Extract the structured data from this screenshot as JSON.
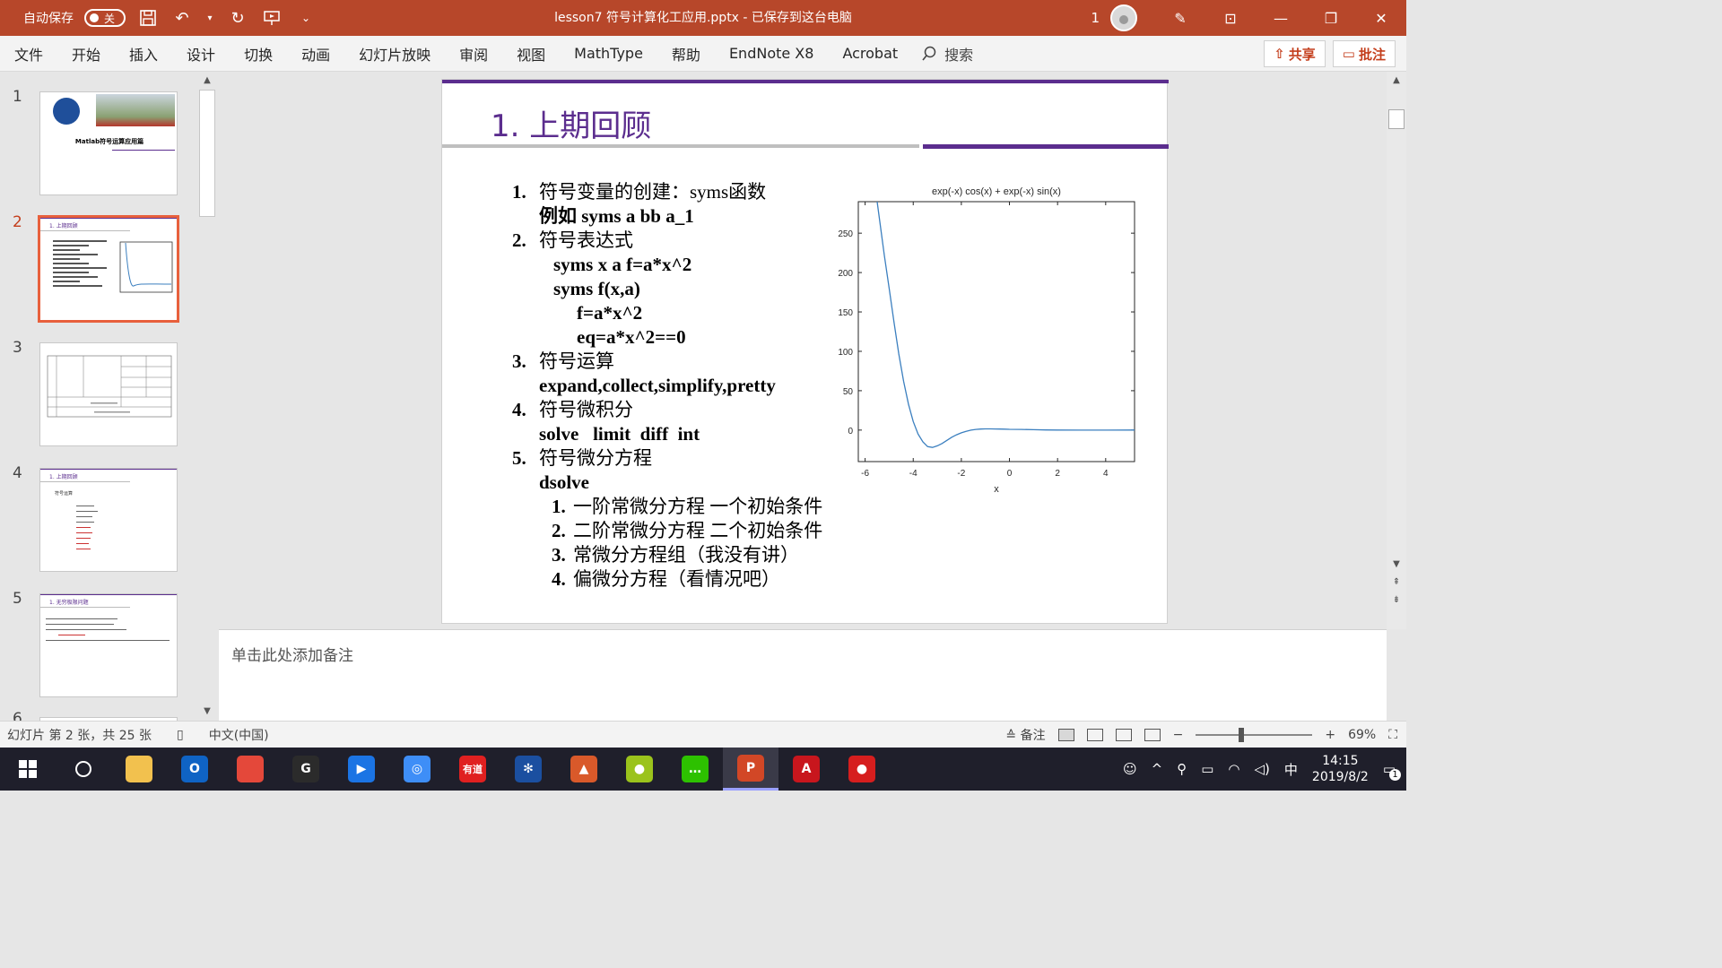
{
  "titlebar": {
    "autosave_label": "自动保存",
    "autosave_state": "关",
    "document_title": "lesson7 符号计算化工应用.pptx - 已保存到这台电脑",
    "account_number": "1",
    "accent_color": "#b7472a"
  },
  "ribbon": {
    "tabs": [
      "文件",
      "开始",
      "插入",
      "设计",
      "切换",
      "动画",
      "幻灯片放映",
      "审阅",
      "视图",
      "MathType",
      "帮助",
      "EndNote X8",
      "Acrobat"
    ],
    "search_label": "搜索",
    "share_label": "共享",
    "comment_label": "批注"
  },
  "thumbnails": {
    "numbers": [
      "1",
      "2",
      "3",
      "4",
      "5",
      "6"
    ],
    "selected": "2",
    "thumb1_title": "Matlab符号运算应用篇",
    "thumb2_title": "1. 上期回顾",
    "thumb4_title": "1. 上期回顾",
    "thumb4_sub": "符号运算",
    "thumb5_title": "1. 无穷极限问题"
  },
  "slide": {
    "title": "1. 上期回顾",
    "accent_color": "#5b2d8e",
    "lines": [
      {
        "num": "1.",
        "text": "符号变量的创建：syms函数"
      },
      {
        "num": "",
        "text": "例如 syms a bb a_1"
      },
      {
        "num": "2.",
        "text": "符号表达式"
      },
      {
        "num": "",
        "text": "syms x a   f=a*x^2"
      },
      {
        "num": "",
        "text": "syms f(x,a)"
      },
      {
        "num": "",
        "text": "f=a*x^2"
      },
      {
        "num": "",
        "text": "eq=a*x^2==0"
      },
      {
        "num": "3.",
        "text": "符号运算"
      },
      {
        "num": "",
        "text": "expand,collect,simplify,pretty"
      },
      {
        "num": "4.",
        "text": "符号微积分"
      },
      {
        "num": "",
        "text": "solve   limit  diff  int"
      },
      {
        "num": "5.",
        "text": "符号微分方程"
      },
      {
        "num": "",
        "text": "dsolve"
      },
      {
        "num": "1.",
        "text": "一阶常微分方程  一个初始条件"
      },
      {
        "num": "2.",
        "text": "二阶常微分方程  二个初始条件"
      },
      {
        "num": "3.",
        "text": "常微分方程组（我没有讲）"
      },
      {
        "num": "4.",
        "text": "偏微分方程（看情况吧）"
      }
    ]
  },
  "chart_data": {
    "type": "line",
    "title": "exp(-x) cos(x) + exp(-x) sin(x)",
    "xlabel": "x",
    "ylabel": "",
    "xlim": [
      -6.283,
      5.2
    ],
    "ylim": [
      -40,
      290
    ],
    "xticks": [
      -6,
      -4,
      -2,
      0,
      2,
      4
    ],
    "yticks": [
      0,
      50,
      100,
      150,
      200,
      250
    ],
    "series": [
      {
        "color": "#3b7fbf",
        "x": [
          -5.5,
          -5.2,
          -5.0,
          -4.8,
          -4.6,
          -4.4,
          -4.2,
          -4.0,
          -3.8,
          -3.6,
          -3.4,
          -3.2,
          -3.0,
          -2.8,
          -2.6,
          -2.4,
          -2.2,
          -2.0,
          -1.8,
          -1.6,
          -1.4,
          -1.2,
          -1.0,
          -0.8,
          -0.6,
          -0.4,
          -0.2,
          0,
          0.5,
          1.0,
          1.5,
          2.0,
          3.0,
          4.0,
          5.0,
          5.2
        ],
        "y": [
          290,
          222,
          180,
          137,
          97,
          62,
          33,
          11,
          -5,
          -15,
          -21,
          -22,
          -20,
          -17,
          -13,
          -9,
          -6,
          -3.5,
          -1.5,
          -0.1,
          0.8,
          1.3,
          1.5,
          1.5,
          1.4,
          1.3,
          1.2,
          1.0,
          0.8,
          0.5,
          0.2,
          0.05,
          -0.05,
          -0.02,
          0.0,
          0.0
        ]
      }
    ]
  },
  "notes": {
    "placeholder": "单击此处添加备注"
  },
  "statusbar": {
    "slide_info": "幻灯片 第 2 张，共 25 张",
    "language": "中文(中国)",
    "notes_label": "备注",
    "zoom": "69%"
  },
  "taskbar": {
    "time": "14:15",
    "date": "2019/8/2",
    "ime": "中",
    "notification_count": "1",
    "apps": [
      {
        "name": "file-explorer",
        "color": "#f2c14e",
        "glyph": ""
      },
      {
        "name": "outlook",
        "color": "#0f63c4",
        "glyph": "O"
      },
      {
        "name": "chrome",
        "color": "#e4483a",
        "glyph": ""
      },
      {
        "name": "app-g",
        "color": "#2b2b2b",
        "glyph": "G"
      },
      {
        "name": "media-player",
        "color": "#1b74e4",
        "glyph": "▶"
      },
      {
        "name": "baidu-netdisk",
        "color": "#3e8ef7",
        "glyph": "◎"
      },
      {
        "name": "youdao",
        "color": "#e02020",
        "glyph": "有道"
      },
      {
        "name": "app-molecule",
        "color": "#1b4fa0",
        "glyph": "✻"
      },
      {
        "name": "matlab",
        "color": "#d9592a",
        "glyph": "▲"
      },
      {
        "name": "app-yellow-green",
        "color": "#9bc31c",
        "glyph": "●"
      },
      {
        "name": "wechat",
        "color": "#2dc100",
        "glyph": "…"
      },
      {
        "name": "powerpoint",
        "color": "#d24726",
        "glyph": "P"
      },
      {
        "name": "acrobat",
        "color": "#c8161d",
        "glyph": "A"
      },
      {
        "name": "recorder",
        "color": "#d61e1e",
        "glyph": "●"
      }
    ]
  }
}
